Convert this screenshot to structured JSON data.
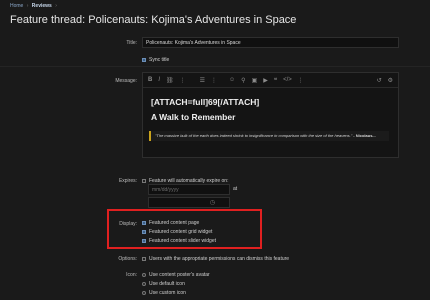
{
  "breadcrumb": {
    "home": "Home",
    "reviews": "Reviews"
  },
  "page_title": "Feature thread: Policenauts: Kojima's Adventures in Space",
  "form": {
    "title_label": "Title:",
    "title_value": "Policenauts: Kojima's Adventures in Space",
    "sync_title": "Sync title",
    "message_label": "Message:",
    "message": {
      "attach": "[ATTACH=full]69[/ATTACH]",
      "heading": "A Walk to Remember",
      "quote": "\"The massive bulk of the earth does indeed shrink to insignificance in comparison with the size of the heavens.\"",
      "quote_author": "- Nicolaus..."
    },
    "expires_label": "Expires:",
    "expires_text": "Feature will automatically expire on:",
    "expires_at": "at",
    "date_placeholder": "mm/dd/yyyy",
    "display_label": "Display:",
    "display_options": [
      "Featured content page",
      "Featured content grid widget",
      "Featured content slider widget"
    ],
    "options_label": "Options:",
    "options_text": "Users with the appropriate permissions can dismiss this feature",
    "icon_label": "Icon:",
    "icon_options": [
      "Use content poster's avatar",
      "Use default icon",
      "Use custom icon"
    ]
  },
  "toolbar_icons": [
    "bold-icon",
    "italic-icon",
    "link-icon",
    "list-icon",
    "smilies-icon",
    "image-icon",
    "media-icon",
    "quote-icon",
    "code-icon",
    "more-icon",
    "undo-icon",
    "settings-icon"
  ],
  "colors": {
    "accent": "#3b5f86",
    "highlight": "#e02020",
    "quote_bar": "#c9a21c"
  }
}
